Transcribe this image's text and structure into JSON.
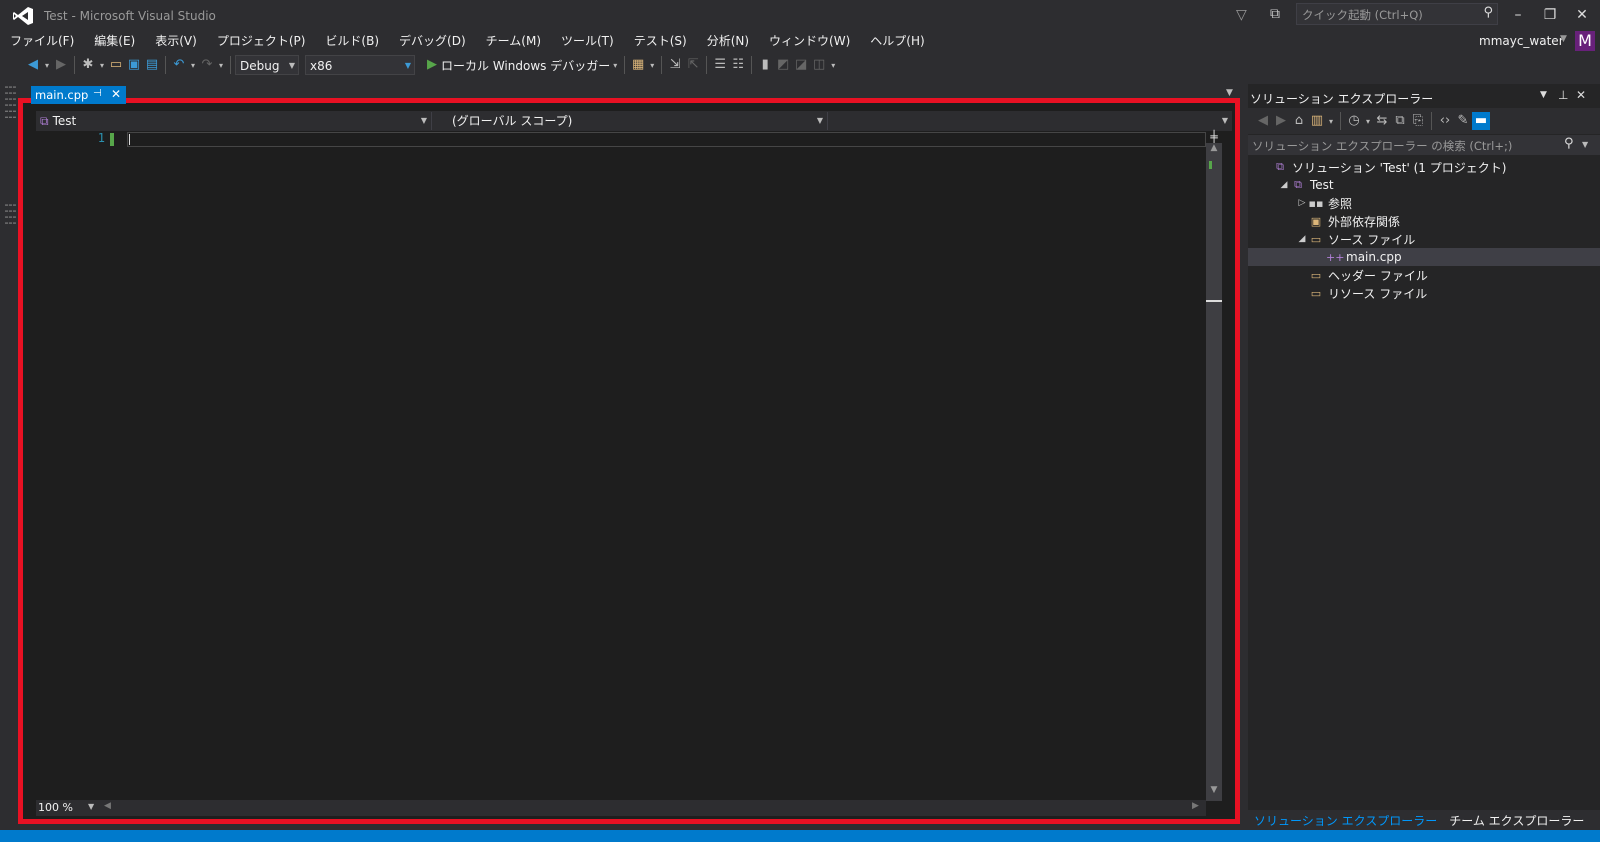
{
  "window": {
    "title": "Test - Microsoft Visual Studio",
    "quick_launch_placeholder": "クイック起動 (Ctrl+Q)",
    "minimize": "–",
    "restore": "❐",
    "close": "✕"
  },
  "menu": [
    "ファイル(F)",
    "編集(E)",
    "表示(V)",
    "プロジェクト(P)",
    "ビルド(B)",
    "デバッグ(D)",
    "チーム(M)",
    "ツール(T)",
    "テスト(S)",
    "分析(N)",
    "ウィンドウ(W)",
    "ヘルプ(H)"
  ],
  "account": {
    "name": "mmayc_water",
    "avatar_letter": "M"
  },
  "toolbar": {
    "configuration": "Debug",
    "platform": "x86",
    "start_label": "ローカル Windows デバッガー"
  },
  "document_tab": {
    "label": "main.cpp"
  },
  "editor": {
    "project_scope": "Test",
    "global_scope": "(グローバル スコープ)",
    "line_numbers": [
      "1"
    ],
    "zoom": "100 %"
  },
  "solution_explorer": {
    "title": "ソリューション エクスプローラー",
    "search_placeholder": "ソリューション エクスプローラー の検索 (Ctrl+;)",
    "tree": [
      {
        "label": "ソリューション 'Test' (1 プロジェクト)",
        "level": 0,
        "expander": "",
        "icon": "solution-icon"
      },
      {
        "label": "Test",
        "level": 1,
        "expander": "◢",
        "icon": "project-icon"
      },
      {
        "label": "参照",
        "level": 2,
        "expander": "▷",
        "icon": "references-icon"
      },
      {
        "label": "外部依存関係",
        "level": 2,
        "expander": "",
        "icon": "external-deps-icon"
      },
      {
        "label": "ソース ファイル",
        "level": 2,
        "expander": "◢",
        "icon": "folder-icon"
      },
      {
        "label": "main.cpp",
        "level": 3,
        "expander": "",
        "icon": "cpp-file-icon",
        "selected": true
      },
      {
        "label": "ヘッダー ファイル",
        "level": 2,
        "expander": "",
        "icon": "folder-icon"
      },
      {
        "label": "リソース ファイル",
        "level": 2,
        "expander": "",
        "icon": "folder-icon"
      }
    ],
    "bottom_tabs": [
      "ソリューション エクスプローラー",
      "チーム エクスプローラー"
    ]
  },
  "colors": {
    "accent": "#007acc",
    "highlight_border": "#e81123",
    "editor_bg": "#1e1e1e"
  }
}
